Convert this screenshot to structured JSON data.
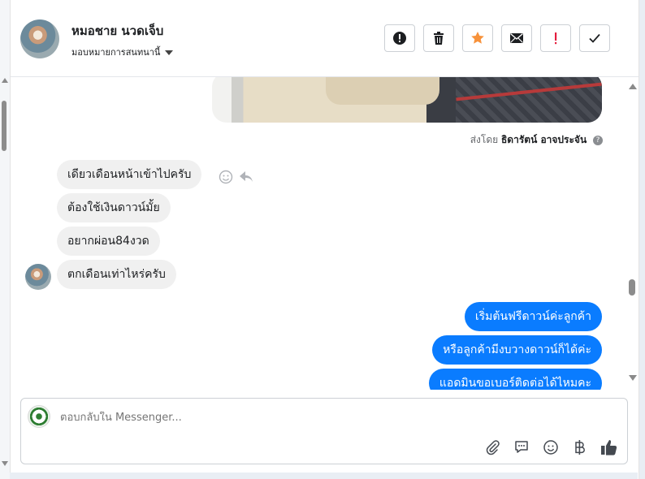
{
  "header": {
    "name": "หมอชาย นวดเจ็บ",
    "assign_label": "มอบหมายการสนทนานี้",
    "actions": [
      "mark-spam",
      "delete",
      "star",
      "mark-unread",
      "follow-up",
      "done"
    ]
  },
  "chat": {
    "sent_by_prefix": "ส่งโดย",
    "sent_by_name": "ธิดารัตน์ อาจประจัน",
    "incoming": [
      "เดียวเดือนหน้าเข้าไปครับ",
      "ต้องใช้เงินดาวน์มั้ย",
      "อยากผ่อน84งวด",
      "ตกเดือนเท่าไหร่ครับ"
    ],
    "outgoing": [
      "เริ่มต้นฟรีดาวน์ค่ะลูกค้า",
      "หรือลูกค้ามีงบวางดาวน์ก็ได้ค่ะ",
      "แอดมินขอเบอร์ติดต่อได้ไหมคะ"
    ]
  },
  "composer": {
    "placeholder": "ตอบกลับใน Messenger...",
    "tools": [
      "attachment-icon",
      "saved-reply-icon",
      "emoji-icon",
      "baht-icon",
      "like-icon"
    ]
  },
  "colors": {
    "outgoing_bubble": "#0a7cff",
    "incoming_bubble": "#f0f0f0",
    "star": "#f7923b",
    "follow_up": "#e41e3f"
  }
}
